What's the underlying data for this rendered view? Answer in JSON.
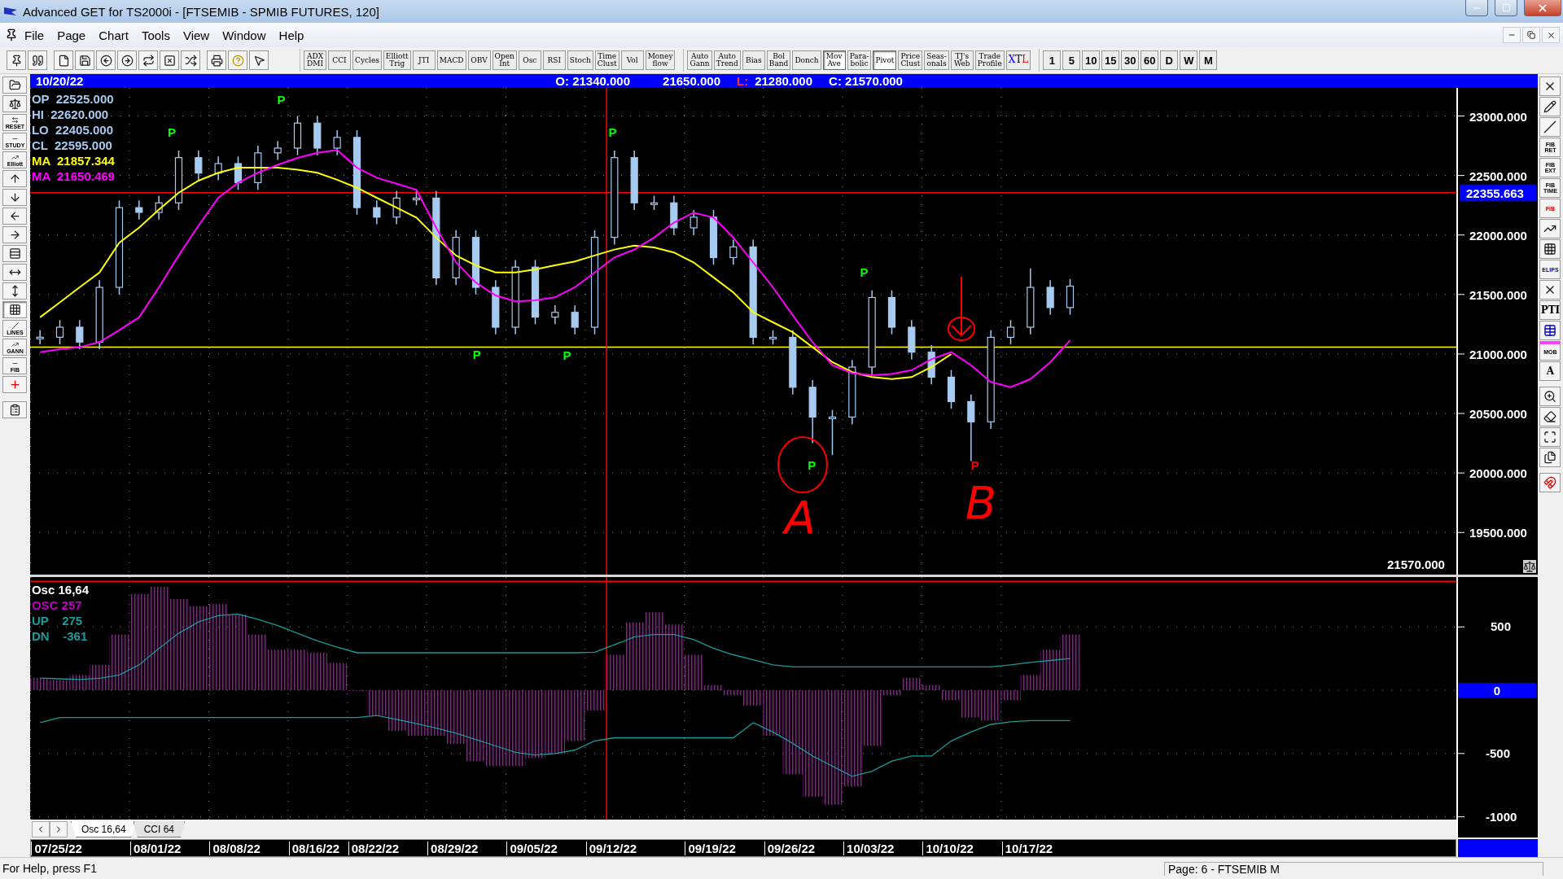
{
  "window": {
    "title": "Advanced GET for TS2000i - [FTSEMIB - SPMIB FUTURES, 120]"
  },
  "menu": [
    "File",
    "Page",
    "Chart",
    "Tools",
    "View",
    "Window",
    "Help"
  ],
  "toolbar": {
    "indicators": [
      {
        "label": "ADX\nDMI"
      },
      {
        "label": "CCI"
      },
      {
        "label": "Cycles"
      },
      {
        "label": "Elliott\nTrig"
      },
      {
        "label": "JTI"
      },
      {
        "label": "MACD"
      },
      {
        "label": "OBV"
      },
      {
        "label": "Open\nInt"
      },
      {
        "label": "Osc"
      },
      {
        "label": "RSI"
      },
      {
        "label": "Stoch"
      },
      {
        "label": "Time\nClust"
      },
      {
        "label": "Vol"
      },
      {
        "label": "Money\nflow"
      }
    ],
    "overlays": [
      {
        "label": "Auto\nGann",
        "selected": false
      },
      {
        "label": "Auto\nTrend",
        "selected": false
      },
      {
        "label": "Bias",
        "selected": false
      },
      {
        "label": "Bol\nBand",
        "selected": false
      },
      {
        "label": "Donch",
        "selected": false
      },
      {
        "label": "Mov\nAve",
        "selected": true
      },
      {
        "label": "Para-\nbolic",
        "selected": false
      },
      {
        "label": "Pivot",
        "selected": true
      },
      {
        "label": "Price\nClust",
        "selected": false
      },
      {
        "label": "Seas-\nonals",
        "selected": false
      },
      {
        "label": "TJ's\nWeb",
        "selected": false
      },
      {
        "label": "Trade\nProfile",
        "selected": false
      },
      {
        "label": "XTL",
        "selected": false,
        "kind": "xtl"
      }
    ],
    "intervals": [
      "1",
      "5",
      "10",
      "15",
      "30",
      "60",
      "D",
      "W",
      "M"
    ]
  },
  "left_tools": [
    {
      "kind": "folder",
      "selected": false
    },
    {
      "kind": "scales",
      "selected": false
    },
    {
      "kind": "reset",
      "label": "RESET",
      "selected": false
    },
    {
      "kind": "study",
      "label": "STUDY",
      "selected": false
    },
    {
      "kind": "elliott",
      "label": "Elliott",
      "selected": false
    },
    {
      "kind": "up",
      "selected": false
    },
    {
      "kind": "down",
      "selected": false
    },
    {
      "kind": "left",
      "selected": false
    },
    {
      "kind": "right",
      "selected": false
    },
    {
      "kind": "bars",
      "selected": false
    },
    {
      "kind": "hzoom",
      "selected": false
    },
    {
      "kind": "vzoom",
      "selected": false
    },
    {
      "kind": "grid",
      "selected": true
    },
    {
      "kind": "lines",
      "label": "LINES",
      "selected": false
    },
    {
      "kind": "gann",
      "label": "GANN",
      "selected": false
    },
    {
      "kind": "fib",
      "label": "FIB",
      "selected": false
    },
    {
      "kind": "cross",
      "selected": false
    },
    {
      "kind": "note",
      "selected": false
    }
  ],
  "right_tools": [
    {
      "kind": "close"
    },
    {
      "kind": "pencil"
    },
    {
      "kind": "channel"
    },
    {
      "kind": "fib",
      "label": "FIB\nRET"
    },
    {
      "kind": "fib",
      "label": "FIB\nEXT"
    },
    {
      "kind": "fib",
      "label": "FIB\nTIME"
    },
    {
      "kind": "arc",
      "label": "FIB"
    },
    {
      "kind": "fan"
    },
    {
      "kind": "grid"
    },
    {
      "kind": "ellipse",
      "label": "ELIPS"
    },
    {
      "kind": "cross-lines"
    },
    {
      "kind": "pti",
      "label": "PTI"
    },
    {
      "kind": "table"
    },
    {
      "kind": "mob",
      "label": "MOB"
    },
    {
      "kind": "font",
      "label": "A"
    },
    {
      "kind": "zoom"
    },
    {
      "kind": "eraser"
    },
    {
      "kind": "expand"
    },
    {
      "kind": "pages"
    },
    {
      "kind": "magnet"
    }
  ],
  "header": {
    "date": "10/20/22",
    "open": "O: 21340.000",
    "high": "21650.000",
    "low_label": "L:",
    "low": "21280.000",
    "close": "C: 21570.000"
  },
  "price_panel": {
    "ohlc": [
      {
        "label": "OP",
        "value": "22525.000"
      },
      {
        "label": "HI",
        "value": "22620.000"
      },
      {
        "label": "LO",
        "value": "22405.000"
      },
      {
        "label": "CL",
        "value": "22595.000"
      }
    ],
    "ma_values": [
      "21857.344",
      "21650.469"
    ],
    "last_price": "21570.000",
    "marker_styles": [
      {
        "color": "#00ff00"
      },
      {
        "color": "#00ff00"
      },
      {
        "color": "#00ff00"
      },
      {
        "color": "#00ff00"
      },
      {
        "color": "#00ff00"
      },
      {
        "color": "#00ff00"
      },
      {
        "color": "#00ff00"
      },
      {
        "color": "#ff0000"
      }
    ],
    "handwritten": [
      "A",
      "B"
    ],
    "chart_data": {
      "type": "candlestick",
      "grid": true,
      "ylim": [
        19146,
        23236
      ],
      "categories": [
        null,
        null,
        null,
        null,
        null,
        null,
        null,
        null,
        null,
        null,
        null,
        null,
        null,
        null,
        null,
        null,
        null,
        null,
        null,
        null,
        null,
        null,
        null,
        null,
        null,
        null,
        null,
        null,
        null,
        null,
        null,
        null,
        null,
        null,
        null,
        null,
        null,
        null,
        null,
        null,
        null,
        null,
        null,
        null,
        null,
        null,
        null,
        null,
        null,
        null,
        null,
        null,
        null,
        null,
        null,
        null,
        null,
        null,
        null,
        null,
        null,
        null,
        null,
        null,
        null,
        null,
        null,
        null,
        null,
        null,
        null,
        null
      ],
      "ohlc": [
        [
          21141,
          21201,
          21081,
          21141
        ],
        [
          21141,
          21285,
          21081,
          21225
        ],
        [
          21225,
          21285,
          21040,
          21100
        ],
        [
          21100,
          21620,
          21040,
          21560
        ],
        [
          21560,
          22290,
          21500,
          22230
        ],
        [
          22230,
          22290,
          22130,
          22190
        ],
        [
          22190,
          22330,
          22130,
          22270
        ],
        [
          22270,
          22710,
          22210,
          22650
        ],
        [
          22650,
          22710,
          22460,
          22520
        ],
        [
          22520,
          22660,
          22460,
          22600
        ],
        [
          22600,
          22660,
          22380,
          22440
        ],
        [
          22440,
          22750,
          22380,
          22690
        ],
        [
          22690,
          22790,
          22630,
          22730
        ],
        [
          22730,
          23000,
          22670,
          22940
        ],
        [
          22940,
          23000,
          22670,
          22730
        ],
        [
          22730,
          22880,
          22670,
          22820
        ],
        [
          22820,
          22880,
          22170,
          22230
        ],
        [
          22230,
          22290,
          22090,
          22150
        ],
        [
          22150,
          22370,
          22090,
          22310
        ],
        [
          22310,
          22370,
          22250,
          22310
        ],
        [
          22310,
          22370,
          21580,
          21640
        ],
        [
          21640,
          22040,
          21580,
          21980
        ],
        [
          21980,
          22040,
          21500,
          21560
        ],
        [
          21560,
          21620,
          21165,
          21225
        ],
        [
          21225,
          21790,
          21165,
          21730
        ],
        [
          21730,
          21790,
          21250,
          21310
        ],
        [
          21310,
          21410,
          21250,
          21350
        ],
        [
          21350,
          21410,
          21165,
          21225
        ],
        [
          21225,
          22040,
          21165,
          21980
        ],
        [
          21980,
          22710,
          21920,
          22650
        ],
        [
          22650,
          22710,
          22210,
          22270
        ],
        [
          22270,
          22330,
          22210,
          22270
        ],
        [
          22270,
          22330,
          22000,
          22060
        ],
        [
          22060,
          22210,
          22000,
          22150
        ],
        [
          22150,
          22210,
          21750,
          21810
        ],
        [
          21810,
          21960,
          21750,
          21900
        ],
        [
          21900,
          21960,
          21080,
          21140
        ],
        [
          21140,
          21200,
          21080,
          21140
        ],
        [
          21140,
          21200,
          20660,
          20720
        ],
        [
          20720,
          20780,
          20250,
          20470
        ],
        [
          20470,
          20530,
          20150,
          20470
        ],
        [
          20470,
          20950,
          20410,
          20890
        ],
        [
          20890,
          21535,
          20830,
          21475
        ],
        [
          21475,
          21535,
          21165,
          21225
        ],
        [
          21225,
          21285,
          20955,
          21015
        ],
        [
          21015,
          21075,
          20745,
          20805
        ],
        [
          20805,
          20865,
          20540,
          20600
        ],
        [
          20600,
          20660,
          20100,
          20430
        ],
        [
          20430,
          21200,
          20370,
          21140
        ],
        [
          21140,
          21285,
          21080,
          21225
        ],
        [
          21225,
          21720,
          21165,
          21560
        ],
        [
          21560,
          21620,
          21330,
          21390
        ],
        [
          21390,
          21630,
          21330,
          21570
        ],
        null,
        null,
        null,
        null,
        null,
        null,
        null,
        null,
        null,
        null,
        null,
        null,
        null,
        null,
        null,
        null,
        null,
        null,
        null
      ],
      "series": [
        {
          "name": "MA",
          "type": "line",
          "color": "#ffff00",
          "values": [
            21308,
            21434,
            21560,
            21685,
            21936,
            22062,
            22213,
            22355,
            22456,
            22523,
            22565,
            22565,
            22565,
            22548,
            22523,
            22464,
            22397,
            22313,
            22230,
            22146,
            21978,
            21828,
            21744,
            21685,
            21685,
            21710,
            21744,
            21777,
            21828,
            21878,
            21911,
            21895,
            21853,
            21769,
            21643,
            21518,
            21350,
            21266,
            21183,
            21057,
            20931,
            20848,
            20806,
            20789,
            20806,
            20890,
            20998,
            null,
            null,
            null,
            null,
            null,
            null,
            null,
            null,
            null,
            null,
            null,
            null,
            null,
            null,
            null,
            null,
            null,
            null,
            null,
            null,
            null,
            null,
            null,
            null,
            null
          ]
        },
        {
          "name": "MA",
          "type": "line",
          "color": "#ff00ff",
          "values": [
            21015,
            21040,
            21057,
            21100,
            21200,
            21308,
            21560,
            21828,
            22079,
            22313,
            22439,
            22523,
            22590,
            22648,
            22690,
            22715,
            22565,
            22481,
            22430,
            22380,
            22062,
            21769,
            21601,
            21492,
            21442,
            21450,
            21476,
            21560,
            21685,
            21811,
            21878,
            21978,
            22104,
            22188,
            22146,
            21978,
            21769,
            21560,
            21325,
            21099,
            20906,
            20839,
            20822,
            20831,
            20864,
            20956,
            21015,
            20906,
            20764,
            20722,
            20789,
            20931,
            21115,
            null,
            null,
            null,
            null,
            null,
            null,
            null,
            null,
            null,
            null,
            null,
            null,
            null,
            null,
            null,
            null,
            null,
            null,
            null
          ]
        }
      ],
      "yticks": [
        {
          "value": 23000,
          "label": "23000.000"
        },
        {
          "value": 22500,
          "label": "22500.000"
        },
        {
          "value": 22000,
          "label": "22000.000"
        },
        {
          "value": 21500,
          "label": "21500.000"
        },
        {
          "value": 21000,
          "label": "21000.000"
        },
        {
          "value": 20500,
          "label": "20500.000"
        },
        {
          "value": 20000,
          "label": "20000.000"
        },
        {
          "value": 19500,
          "label": "19500.000"
        }
      ],
      "ref_lines": [
        {
          "axis": "y",
          "value": 22355.663,
          "label": "22355.663",
          "color": "#ff0000"
        },
        {
          "axis": "y",
          "value": 21057,
          "color": "#ffff00"
        }
      ],
      "annotations": [
        "P",
        "P",
        "P",
        "P",
        "P",
        "P",
        "P",
        "P"
      ]
    }
  },
  "osc_panel": {
    "title": "Osc 16,64",
    "legend_values": [
      "257",
      "275",
      "-361"
    ],
    "chart_data": {
      "type": "bar",
      "grid": true,
      "ylim": [
        -1022,
        894
      ],
      "categories": [
        null,
        "07/25/22",
        null,
        null,
        null,
        null,
        "08/01/22",
        null,
        null,
        null,
        "08/08/22",
        null,
        null,
        null,
        "08/16/22",
        null,
        null,
        "08/22/22",
        null,
        null,
        null,
        "08/29/22",
        null,
        null,
        null,
        "09/05/22",
        null,
        null,
        null,
        "09/12/22",
        null,
        null,
        null,
        null,
        "09/19/22",
        null,
        null,
        null,
        "09/26/22",
        null,
        null,
        null,
        "10/03/22",
        null,
        null,
        null,
        "10/10/22",
        null,
        null,
        null,
        "10/17/22",
        null,
        null,
        null,
        null,
        null,
        null,
        null,
        null,
        null,
        null,
        null,
        null,
        null,
        null,
        null,
        null,
        null,
        null,
        null,
        null,
        null
      ],
      "series": [
        {
          "name": "OSC",
          "color": "#c000c0",
          "values": [
            96,
            80,
            120,
            200,
            440,
            760,
            816,
            720,
            664,
            680,
            600,
            440,
            320,
            320,
            296,
            216,
            0,
            -200,
            -320,
            -360,
            -360,
            -424,
            -560,
            -600,
            -600,
            -536,
            -504,
            -400,
            -160,
            280,
            536,
            616,
            520,
            280,
            40,
            -40,
            -120,
            -360,
            -664,
            -840,
            -904,
            -760,
            -440,
            -40,
            96,
            40,
            -80,
            -216,
            -240,
            -80,
            120,
            320,
            440,
            null,
            null,
            null,
            null,
            null,
            null,
            null,
            null,
            null,
            null,
            null,
            null,
            null,
            null,
            null,
            null,
            null,
            null,
            null
          ]
        },
        {
          "name": "UP",
          "type": "line",
          "color": "#1a9a9a",
          "values": [
            96,
            90,
            85,
            95,
            120,
            200,
            330,
            450,
            540,
            590,
            600,
            560,
            510,
            450,
            390,
            340,
            296,
            296,
            296,
            296,
            296,
            296,
            296,
            296,
            296,
            296,
            296,
            296,
            300,
            360,
            420,
            440,
            440,
            400,
            330,
            280,
            240,
            200,
            184,
            184,
            184,
            184,
            184,
            184,
            184,
            184,
            184,
            184,
            184,
            200,
            220,
            235,
            250,
            null,
            null,
            null,
            null,
            null,
            null,
            null,
            null,
            null,
            null,
            null,
            null,
            null,
            null,
            null,
            null,
            null,
            null,
            null
          ]
        },
        {
          "name": "DN",
          "type": "line",
          "color": "#1a9a9a",
          "values": [
            -256,
            -216,
            -216,
            -216,
            -216,
            -216,
            -216,
            -216,
            -216,
            -216,
            -216,
            -216,
            -216,
            -216,
            -216,
            -216,
            -216,
            -200,
            -230,
            -264,
            -300,
            -340,
            -390,
            -440,
            -490,
            -512,
            -500,
            -472,
            -400,
            -376,
            -376,
            -376,
            -376,
            -376,
            -376,
            -376,
            -256,
            -330,
            -420,
            -520,
            -600,
            -680,
            -640,
            -560,
            -520,
            -520,
            -400,
            -330,
            -270,
            -250,
            -240,
            -240,
            -240,
            null,
            null,
            null,
            null,
            null,
            null,
            null,
            null,
            null,
            null,
            null,
            null,
            null,
            null,
            null,
            null,
            null,
            null,
            null
          ]
        }
      ],
      "yticks": [
        500,
        0,
        -500,
        -1000
      ],
      "ref_lines": [
        {
          "axis": "y",
          "value": 860,
          "color": "#ff0000"
        }
      ]
    }
  },
  "tabs": [
    {
      "label": "Osc 16,64",
      "selected": true
    },
    {
      "label": "CCI 64",
      "selected": false
    }
  ],
  "status_bar": {
    "help": "For Help, press F1",
    "page": "Page: 6 - FTSEMIB M"
  }
}
